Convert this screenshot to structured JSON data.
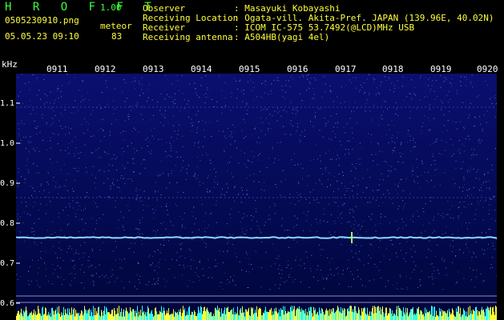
{
  "app": {
    "title": "H R O F F T",
    "version": "1.00"
  },
  "file": {
    "name": "0505230910.png",
    "datetime": "05.05.23 09:10",
    "mode": "meteor",
    "count": "83"
  },
  "info": {
    "observer_label": "Observer",
    "observer_value": ": Masayuki Kobayashi",
    "location_label": "Receiving Location",
    "location_value": ": Ogata-vill. Akita-Pref. JAPAN (139.96E, 40.02N)",
    "receiver_label": "Receiver",
    "receiver_value": ": ICOM IC-575 53.7492(@LCD)MHz USB",
    "antenna_label": "Receiving antenna",
    "antenna_value": ": A504HB(yagi 4el)"
  },
  "spectrogram": {
    "y_unit": "kHz",
    "y_ticks": [
      "1.1",
      "1.0",
      "0.9",
      "0.8",
      "0.7",
      "0.6"
    ],
    "time_labels": [
      "0911",
      "0912",
      "0913",
      "0914",
      "0915",
      "0916",
      "0917",
      "0918",
      "0919",
      "0920"
    ],
    "colors": {
      "bg_top": "#0a0f70",
      "bg_bottom": "#00063a",
      "carrier": "#8ed7ff",
      "histogram": "#ffff3c",
      "histogram_alt": "#28ffff"
    }
  }
}
